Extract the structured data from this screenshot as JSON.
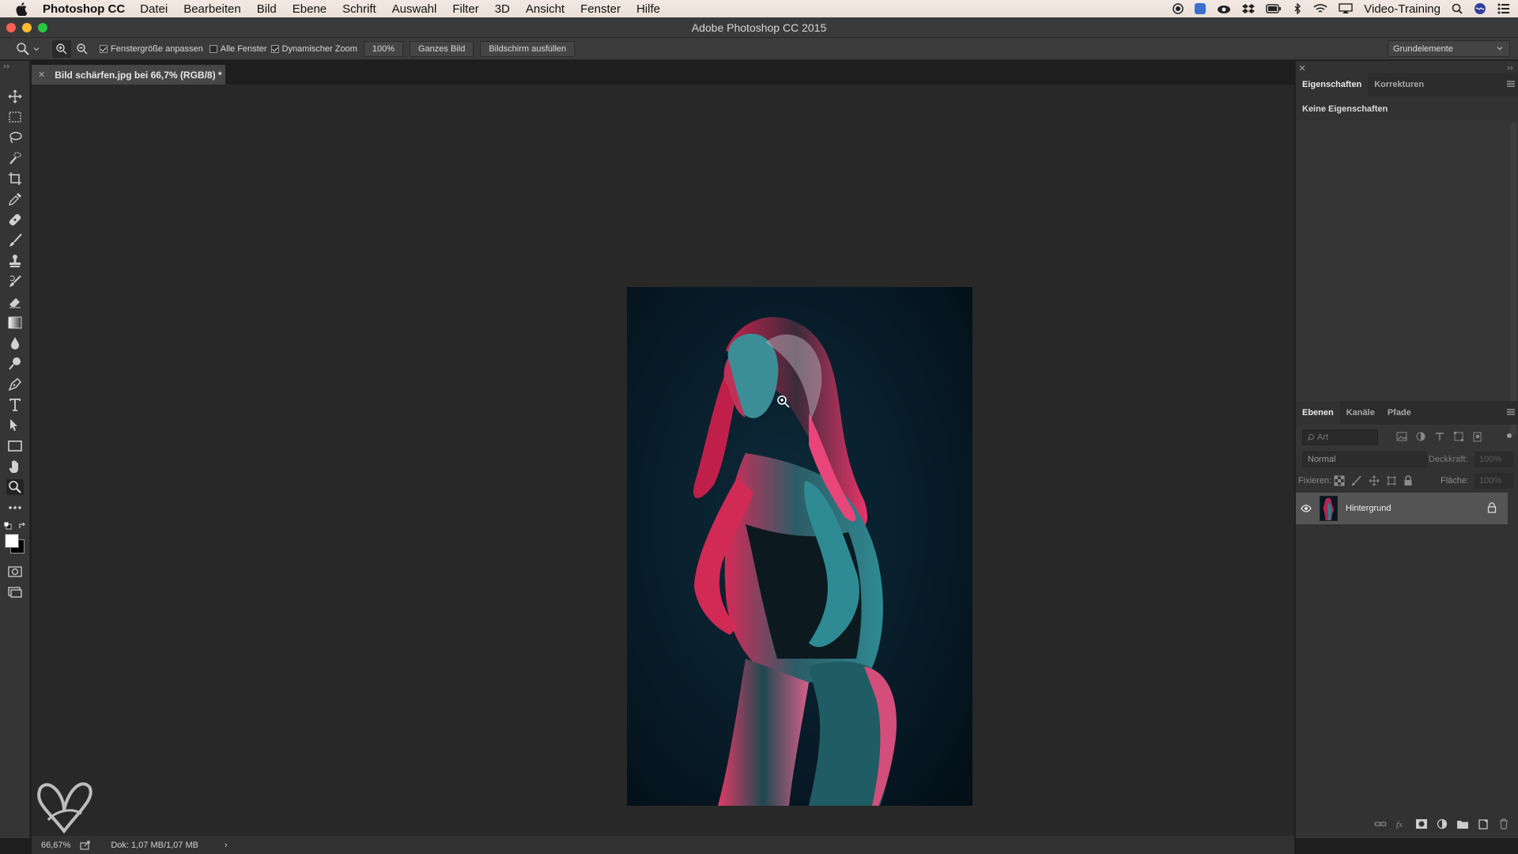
{
  "menubar": {
    "app": "Photoshop CC",
    "items": [
      "Datei",
      "Bearbeiten",
      "Bild",
      "Ebene",
      "Schrift",
      "Auswahl",
      "Filter",
      "3D",
      "Ansicht",
      "Fenster",
      "Hilfe"
    ],
    "user": "Video-Training"
  },
  "window": {
    "title": "Adobe Photoshop CC 2015"
  },
  "options": {
    "resize_windows_label": "Fenstergröße anpassen",
    "resize_windows_checked": true,
    "all_windows_label": "Alle Fenster",
    "all_windows_checked": false,
    "scrubby_zoom_label": "Dynamischer Zoom",
    "scrubby_zoom_checked": true,
    "btn_100": "100%",
    "btn_fit": "Ganzes Bild",
    "btn_fill": "Bildschirm ausfüllen",
    "workspace": "Grundelemente"
  },
  "document": {
    "tab_title": "Bild schärfen.jpg bei 66,7% (RGB/8) *"
  },
  "status": {
    "zoom": "66,67%",
    "doc_size": "Dok: 1,07 MB/1,07 MB",
    "arrow": "›"
  },
  "properties": {
    "tabs": [
      "Eigenschaften",
      "Korrekturen"
    ],
    "message": "Keine Eigenschaften"
  },
  "layers": {
    "tabs": [
      "Ebenen",
      "Kanäle",
      "Pfade"
    ],
    "filter_placeholder": "Art",
    "blend_mode": "Normal",
    "opacity_label": "Deckkraft:",
    "opacity_value": "100%",
    "lock_label": "Fixieren:",
    "fill_label": "Fläche:",
    "fill_value": "100%",
    "items": [
      {
        "name": "Hintergrund",
        "visible": true,
        "locked": true
      }
    ]
  },
  "colors": {
    "accent": "#e42c64",
    "canvas_bg": "#282828",
    "panel_bg": "#323232"
  }
}
